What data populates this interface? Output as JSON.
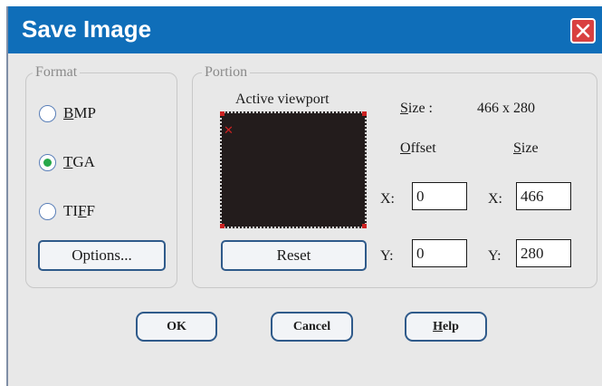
{
  "dialog": {
    "title": "Save Image"
  },
  "format": {
    "legend": "Format",
    "options": [
      {
        "prefix": "",
        "mnemonic": "B",
        "suffix": "MP",
        "checked": false
      },
      {
        "prefix": "",
        "mnemonic": "T",
        "suffix": "GA",
        "checked": true
      },
      {
        "prefix": "TI",
        "mnemonic": "F",
        "suffix": "F",
        "checked": false
      }
    ],
    "options_button": "Options..."
  },
  "portion": {
    "legend": "Portion",
    "viewport_label": "Active viewport",
    "reset_button": "Reset",
    "size_label": {
      "mnemonic": "S",
      "rest": "ize :"
    },
    "size_value": "466 x 280",
    "offset_header": {
      "mnemonic": "O",
      "rest": "ffset"
    },
    "size_header": {
      "mnemonic": "S",
      "rest": "ize"
    },
    "x_label": "X:",
    "y_label": "Y:",
    "offset_x": "0",
    "offset_y": "0",
    "size_x": "466",
    "size_y": "280"
  },
  "buttons": {
    "ok": "OK",
    "cancel": "Cancel",
    "help": {
      "mnemonic": "H",
      "rest": "elp"
    }
  },
  "colors": {
    "titlebar": "#0f6eb9",
    "close": "#d94040",
    "radio_checked": "#27a84a",
    "viewport": "#231c1c",
    "button_border": "#2f5a8a"
  }
}
